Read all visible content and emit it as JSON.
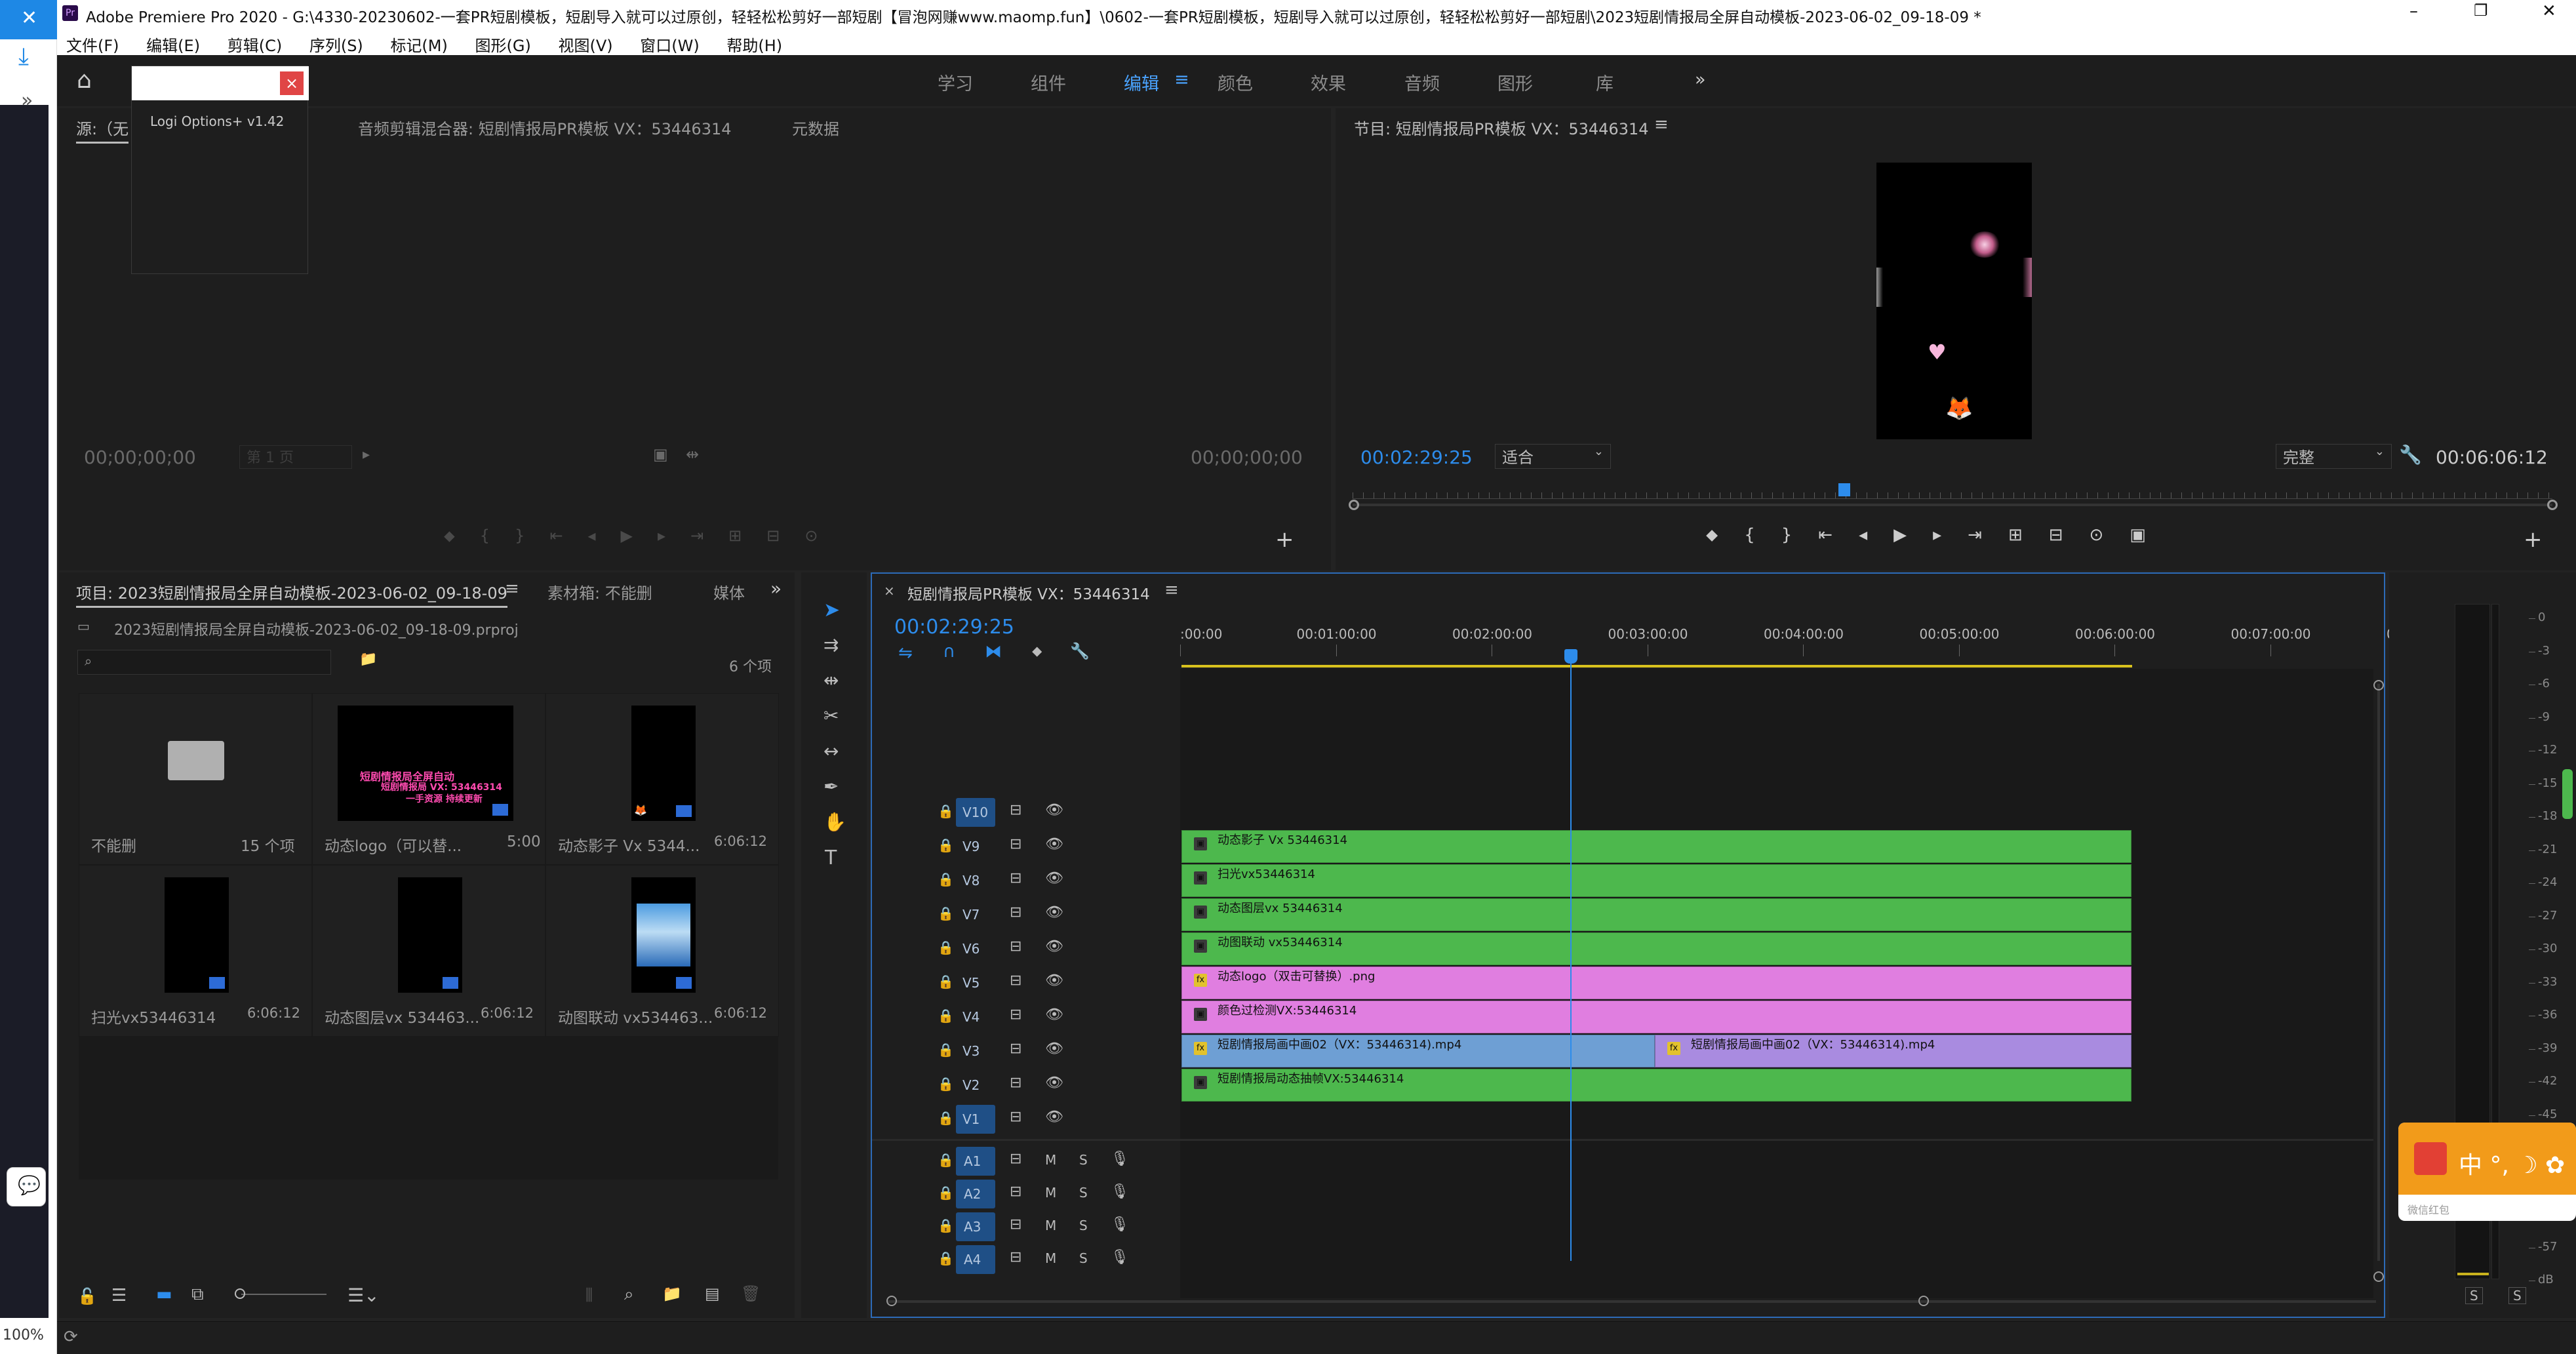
{
  "app": {
    "title": "Adobe Premiere Pro 2020 - G:\\4330-20230602-一套PR短剧模板，短剧导入就可以过原创，轻轻松松剪好一部短剧【冒泡网赚www.maomp.fun】\\0602-一套PR短剧模板，短剧导入就可以过原创，轻轻松松剪好一部短剧\\2023短剧情报局全屏自动模板-2023-06-02_09-18-09 *",
    "icon_label": "Pr"
  },
  "window_controls": {
    "minimize": "–",
    "maximize": "❐",
    "close": "✕"
  },
  "menu": [
    "文件(F)",
    "编辑(E)",
    "剪辑(C)",
    "序列(S)",
    "标记(M)",
    "图形(G)",
    "视图(V)",
    "窗口(W)",
    "帮助(H)"
  ],
  "workspaces": [
    "学习",
    "组件",
    "编辑",
    "颜色",
    "效果",
    "音频",
    "图形",
    "库"
  ],
  "workspace_active": "编辑",
  "workspace_menu_icon": "≡",
  "workspace_more": "»",
  "popup": {
    "title": "Logi Options+ v1.42",
    "close": "×"
  },
  "source_panel": {
    "tab_source": "源:（无",
    "tab_mixer": "音频剪辑混合器: 短剧情报局PR模板 VX：53446314",
    "tab_meta": "元数据",
    "timecode_left": "00;00;00;00",
    "page_select": "第 1 页",
    "timecode_right": "00;00;00;00"
  },
  "program_panel": {
    "title": "节目: 短剧情报局PR模板 VX：53446314",
    "timecode": "00:02:29:25",
    "fit": "适合",
    "quality": "完整",
    "duration": "00:06:06:12",
    "playhead_fraction": 0.41
  },
  "project_panel": {
    "tab_project": "项目: 2023短剧情报局全屏自动模板-2023-06-02_09-18-09",
    "tab_bin": "素材箱: 不能删",
    "tab_media": "媒体",
    "filename": "2023短剧情报局全屏自动模板-2023-06-02_09-18-09.prproj",
    "item_count": "6 个项",
    "items": [
      {
        "name": "不能删",
        "meta": "15 个项",
        "kind": "folder"
      },
      {
        "name": "动态logo（可以替...",
        "meta": "5:00",
        "kind": "logo"
      },
      {
        "name": "动态影子 Vx 5344...",
        "meta": "6:06:12",
        "kind": "video"
      },
      {
        "name": "扫光vx53446314",
        "meta": "6:06:12",
        "kind": "video"
      },
      {
        "name": "动态图层vx 534463...",
        "meta": "6:06:12",
        "kind": "video"
      },
      {
        "name": "动图联动 vx534463...",
        "meta": "6:06:12",
        "kind": "sky"
      }
    ],
    "logo_text": [
      "短剧情报局全屏自动",
      "短剧情报局 VX: 53446314",
      "一手资源 持续更新"
    ]
  },
  "timeline": {
    "sequence_name": "短剧情报局PR模板 VX：53446314",
    "timecode": "00:02:29:25",
    "ruler": [
      ":00:00",
      "00:01:00:00",
      "00:02:00:00",
      "00:03:00:00",
      "00:04:00:00",
      "00:05:00:00",
      "00:06:00:00",
      "00:07:00:00",
      "00"
    ],
    "video_tracks": [
      {
        "id": "V10",
        "active": true,
        "clips": []
      },
      {
        "id": "V9",
        "clips": [
          {
            "name": "动态影子 Vx 53446314",
            "color": "#4db84d",
            "start": 0,
            "end": 6.1
          }
        ]
      },
      {
        "id": "V8",
        "clips": [
          {
            "name": "扫光vx53446314",
            "color": "#4db84d",
            "start": 0,
            "end": 6.1
          }
        ]
      },
      {
        "id": "V7",
        "clips": [
          {
            "name": "动态图层vx 53446314",
            "color": "#4db84d",
            "start": 0,
            "end": 6.1
          }
        ]
      },
      {
        "id": "V6",
        "clips": [
          {
            "name": "动图联动 vx53446314",
            "color": "#4db84d",
            "start": 0,
            "end": 6.1
          }
        ]
      },
      {
        "id": "V5",
        "clips": [
          {
            "name": "动态logo（双击可替换）.png",
            "color": "#e07ee0",
            "start": 0,
            "end": 6.1,
            "fx": true
          }
        ]
      },
      {
        "id": "V4",
        "clips": [
          {
            "name": "颜色过检测VX:53446314",
            "color": "#e07ee0",
            "start": 0,
            "end": 6.1
          }
        ]
      },
      {
        "id": "V3",
        "clips": [
          {
            "name": "短剧情报局画中画02（VX：53446314).mp4",
            "color": "#6e9fd4",
            "start": 0,
            "end": 3.04,
            "fx": true
          },
          {
            "name": "短剧情报局画中画02（VX：53446314).mp4",
            "color": "#a98be0",
            "start": 3.04,
            "end": 6.1,
            "fx": true
          }
        ]
      },
      {
        "id": "V2",
        "clips": [
          {
            "name": "短剧情报局动态抽帧VX:53446314",
            "color": "#4db84d",
            "start": 0,
            "end": 6.1
          }
        ]
      },
      {
        "id": "V1",
        "active": true,
        "clips": []
      }
    ],
    "audio_tracks": [
      "A1",
      "A2",
      "A3",
      "A4"
    ],
    "audio_buttons": {
      "mute": "M",
      "solo": "S"
    },
    "playhead_minutes": 2.497
  },
  "meter": {
    "ticks": [
      "0",
      "-3",
      "-6",
      "-9",
      "-12",
      "-15",
      "-18",
      "-21",
      "-24",
      "-27",
      "-30",
      "-33",
      "-36",
      "-39",
      "-42",
      "-45",
      "-48",
      "-51",
      "-54",
      "-57",
      "dB"
    ],
    "solo_labels": [
      "S",
      "S"
    ]
  },
  "ime": {
    "text": "中 °, ☽ ✿",
    "sub": "微信红包"
  },
  "zoom": "100%",
  "colors": {
    "accent": "#2d8ceb",
    "green_clip": "#4db84d",
    "pink_clip": "#e07ee0",
    "blue_clip": "#6e9fd4",
    "purple_clip": "#a98be0"
  }
}
